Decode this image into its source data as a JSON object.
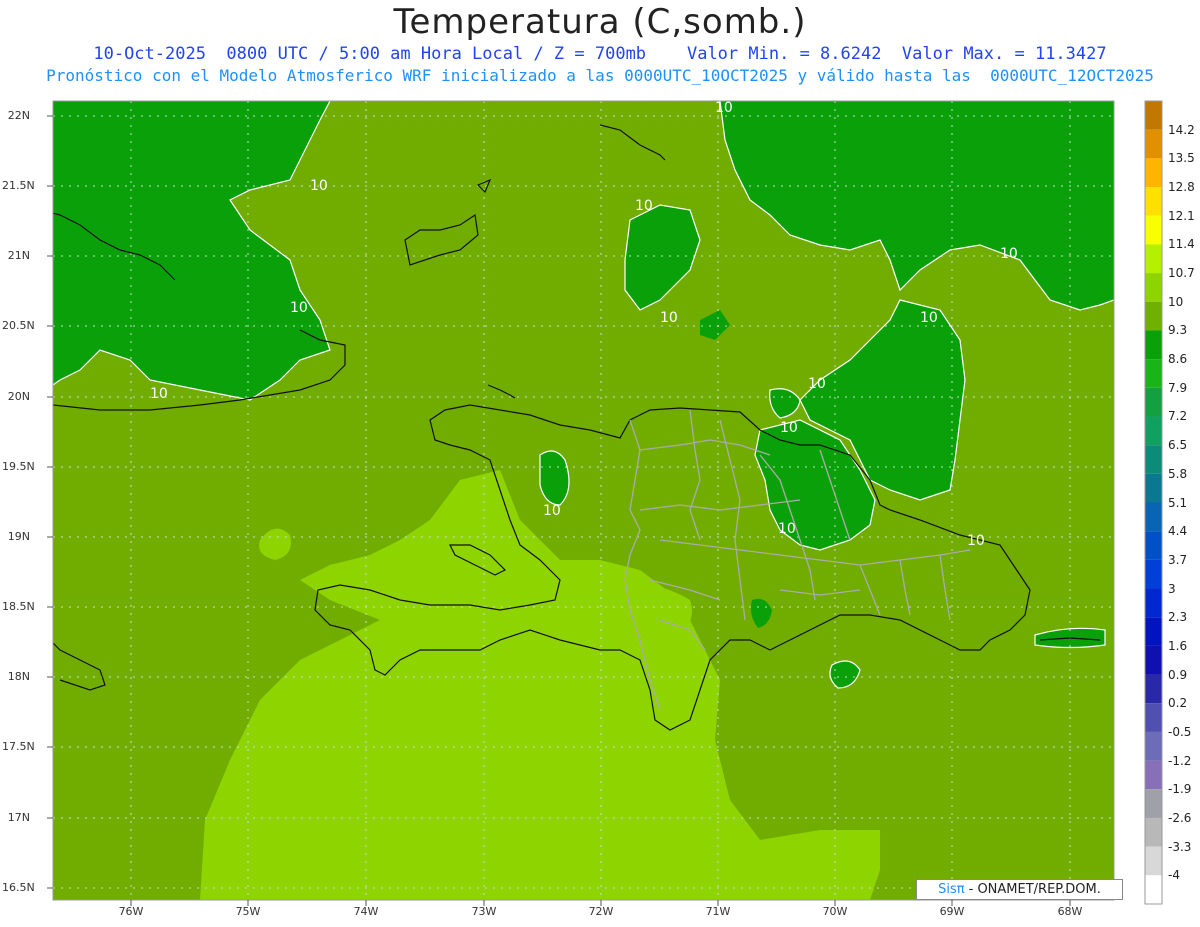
{
  "title": "Temperatura (C,somb.)",
  "subtitle_line1": "10-Oct-2025  0800 UTC / 5:00 am Hora Local / Z = 700mb    Valor Min. = 8.6242  Valor Max. = 11.3427",
  "subtitle_line2": "Pronóstico con el Modelo Atmosferico WRF inicializado a las 0000UTC_10OCT2025 y válido hasta las  0000UTC_12OCT2025",
  "lat_labels": [
    "22N",
    "21.5N",
    "21N",
    "20.5N",
    "20N",
    "19.5N",
    "19N",
    "18.5N",
    "18N",
    "17.5N",
    "17N",
    "16.5N"
  ],
  "lon_labels": [
    "76W",
    "75W",
    "74W",
    "73W",
    "72W",
    "71W",
    "70W",
    "69W",
    "68W"
  ],
  "contour_label": "10",
  "colorbar": [
    {
      "label": "14.2",
      "color": "#c07800"
    },
    {
      "label": "13.5",
      "color": "#e09000"
    },
    {
      "label": "12.8",
      "color": "#ffb400"
    },
    {
      "label": "12.1",
      "color": "#ffe000"
    },
    {
      "label": "11.4",
      "color": "#f8ff00"
    },
    {
      "label": "10.7",
      "color": "#b4f000"
    },
    {
      "label": "10",
      "color": "#8ed400"
    },
    {
      "label": "9.3",
      "color": "#70b000"
    },
    {
      "label": "8.6",
      "color": "#0aa00a"
    },
    {
      "label": "7.9",
      "color": "#18b418"
    },
    {
      "label": "7.2",
      "color": "#14a040"
    },
    {
      "label": "6.5",
      "color": "#10a060"
    },
    {
      "label": "5.8",
      "color": "#0c8c78"
    },
    {
      "label": "5.1",
      "color": "#0a7890"
    },
    {
      "label": "4.4",
      "color": "#0a64b4"
    },
    {
      "label": "3.7",
      "color": "#0050c8"
    },
    {
      "label": "3",
      "color": "#0040d8"
    },
    {
      "label": "2.3",
      "color": "#0028d0"
    },
    {
      "label": "1.6",
      "color": "#0014c0"
    },
    {
      "label": "0.9",
      "color": "#1010b0"
    },
    {
      "label": "0.2",
      "color": "#2828a8"
    },
    {
      "label": "-0.5",
      "color": "#5050b0"
    },
    {
      "label": "-1.2",
      "color": "#6c6cb8"
    },
    {
      "label": "-1.9",
      "color": "#8870b8"
    },
    {
      "label": "-2.6",
      "color": "#a0a0a8"
    },
    {
      "label": "-3.3",
      "color": "#b8b8b8"
    },
    {
      "label": "-4",
      "color": "#d8d8d8"
    },
    {
      "label": "",
      "color": "#ffffff"
    }
  ],
  "credit_brand": "Sisπ",
  "credit_text": "- ONAMET/REP.DOM.",
  "map_colors": {
    "base": "#71ad00",
    "dark_green": "#0aa00a",
    "light_green": "#8ed400",
    "coast": "#111111",
    "borders": "#aaaaaa",
    "contour": "#ffffff",
    "grid": "#cfd8cf"
  }
}
